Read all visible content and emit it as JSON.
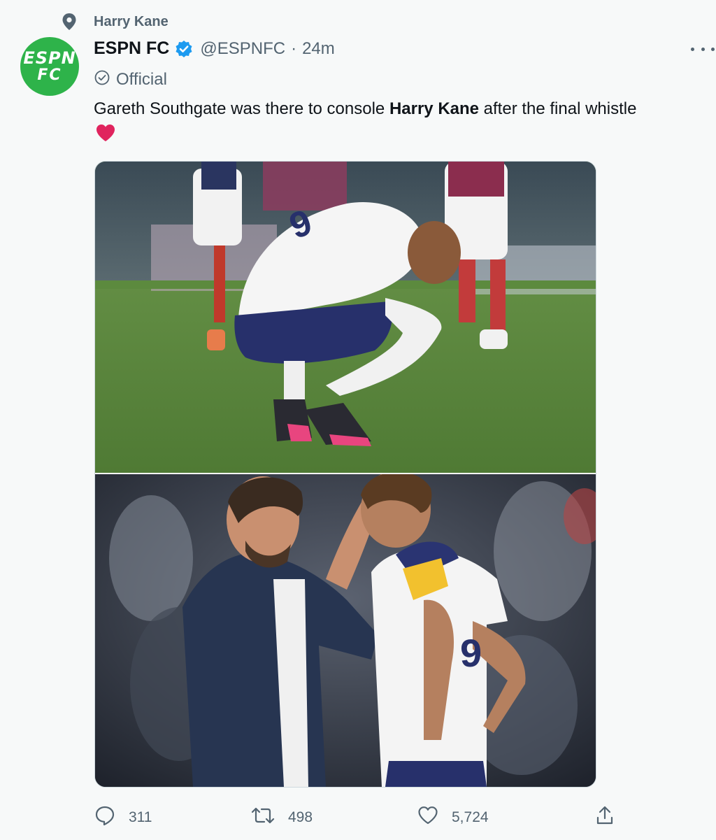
{
  "social_context": {
    "label": "Harry Kane",
    "icon": "topic-pin-icon"
  },
  "author": {
    "avatar_line1": "ESPN",
    "avatar_line2": "FC",
    "avatar_color": "#2eb34a",
    "name": "ESPN FC",
    "handle": "@ESPNFC",
    "separator": "·",
    "time": "24m",
    "badge_color": "#1d9bf0",
    "official_label": "Official"
  },
  "tweet": {
    "text_before": "Gareth Southgate was there to console ",
    "text_bold": "Harry Kane",
    "text_after": " after the final whistle",
    "emoji": "red-heart"
  },
  "media": {
    "photos": [
      {
        "name": "photo-kane-crouching",
        "subject": "player crouching on pitch"
      },
      {
        "name": "photo-southgate-consoling",
        "subject": "coach consoling player"
      }
    ]
  },
  "actions": {
    "replies": "311",
    "retweets": "498",
    "likes": "5,724"
  },
  "colors": {
    "text": "#0f1419",
    "muted": "#536471",
    "background": "#f7f9f9",
    "heart": "#e0245e"
  }
}
